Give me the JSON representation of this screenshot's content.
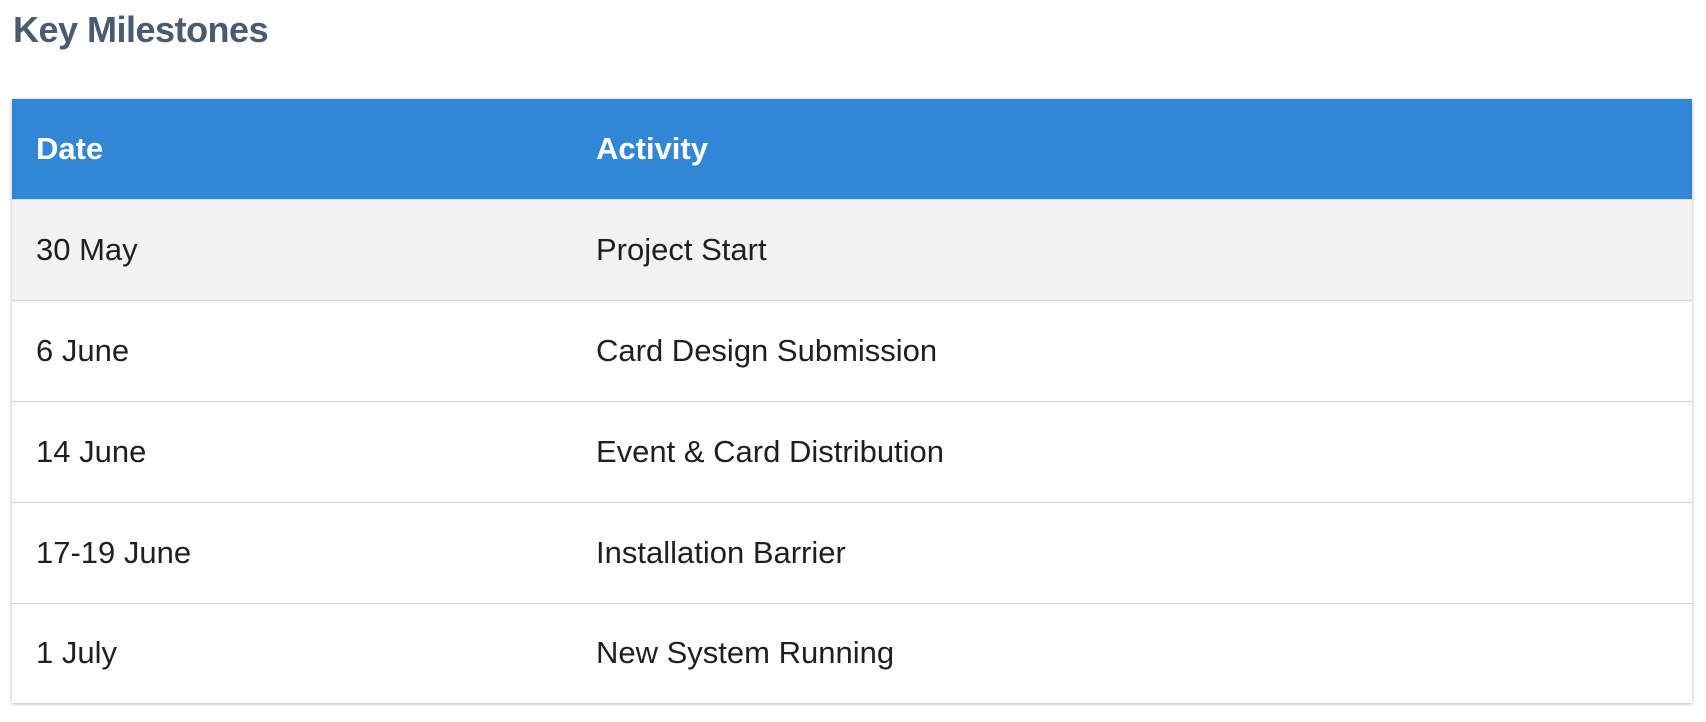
{
  "page": {
    "title": "Key Milestones"
  },
  "table": {
    "columns": [
      "Date",
      "Activity"
    ],
    "rows": [
      {
        "date": "30 May",
        "activity": "Project Start"
      },
      {
        "date": "6 June",
        "activity": "Card Design Submission"
      },
      {
        "date": "14 June",
        "activity": "Event & Card Distribution"
      },
      {
        "date": "17-19 June",
        "activity": "Installation Barrier"
      },
      {
        "date": "1 July",
        "activity": "New System Running"
      }
    ]
  },
  "colors": {
    "header_bg": "#3187d6",
    "title_color": "#4a5a70",
    "shaded_row": "#f2f2f2"
  }
}
